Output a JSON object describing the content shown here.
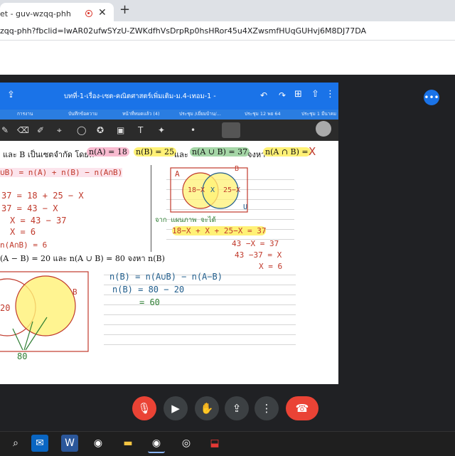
{
  "browser": {
    "tab_title": "et - guv-wzqq-phh",
    "tab_close": "✕",
    "new_tab": "+",
    "url": "zqq-phh?fbclid=IwAR02ufwSYzU-ZWKdfhVsDrpRp0hsHRor45u4XZwsmfHUqGUHvj6M8DJ77DA"
  },
  "shared_app": {
    "doc_title": "บทที่-1-เรื่อง-เซต-คณิตศาสตร์เพิ่มเติม-ม.4-เทอม-1 -",
    "tabs": [
      "การงาน",
      "บันทึกข้อความ",
      "หน้าที่หมดแล้ว (4)",
      "ประชุม /เยี่ยมบ้าน/...",
      "ประชุม 12 พย 64",
      "ประชุม 1 มีนาคม"
    ]
  },
  "whiteboard": {
    "q1_prefix": "และ B เป็นเซตจำกัด โดยที่",
    "q1_nA": "n(A) = 18",
    "q1_nB": "n(B) = 25",
    "q1_and": "และ",
    "q1_nAuB": "n(A ∪ B) = 37",
    "q1_find": "จงหา",
    "q1_nAnB": "n(A ∩ B) =",
    "q1_X": "X",
    "formula": "∪B) = n(A) + n(B) − n(A∩B)",
    "step1": "37 = 18 + 25 − X",
    "step2": "37 = 43 − X",
    "step3": "X = 43 − 37",
    "step4": "X = 6",
    "step5": "n(A∩B) = 6",
    "venn1_A": "A",
    "venn1_B": "B",
    "venn1_U": "U",
    "venn1_left": "18−X",
    "venn1_mid": "X",
    "venn1_right": "25−X",
    "venn1_note": "จาก แผนภาพ จะได้",
    "venn1_eq": "18−X + X + 25−X = 37",
    "venn1_s1": "43 −X = 37",
    "venn1_s2": "43 −37 = X",
    "venn1_s3": "X = 6",
    "q2": "(A − B) = 20 และ n(A ∪ B) = 80 จงหา n(B)",
    "q2_l1": "n(B) = n(A∪B) − n(A−B)",
    "q2_l2": "n(B) = 80 − 20",
    "q2_l3": "= 60",
    "venn2_20": "20",
    "venn2_B": "B",
    "venn2_80": "80"
  },
  "controls": {
    "mic": "mic-off",
    "camera": "camera",
    "hand": "raise-hand",
    "present": "present",
    "more": "more",
    "hangup": "hang-up"
  },
  "colors": {
    "meet_bg": "#202124",
    "app_blue": "#1a73e8",
    "hangup_red": "#ea4335",
    "highlight_yellow": "#fff176",
    "highlight_pink": "#f8bbd0",
    "highlight_green": "#a5d6a7"
  }
}
